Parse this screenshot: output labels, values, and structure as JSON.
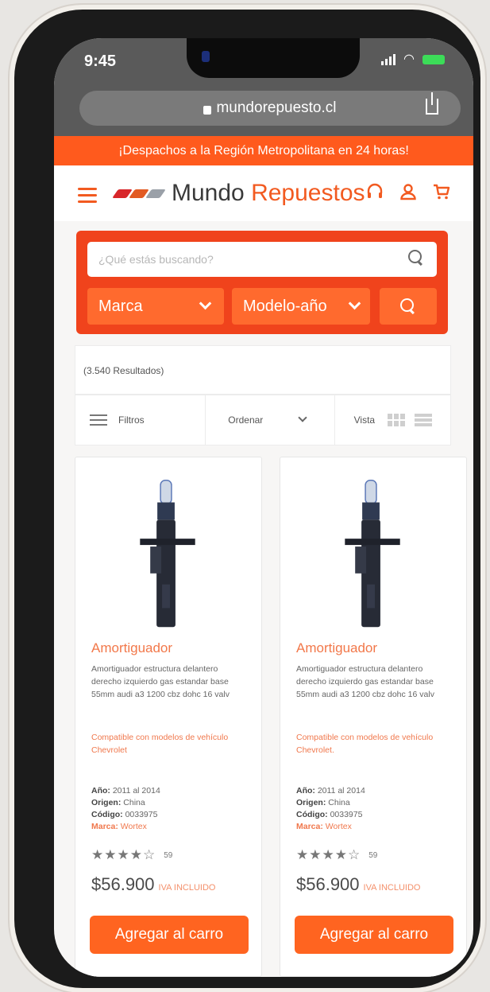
{
  "status": {
    "time": "9:45"
  },
  "browser": {
    "url": "mundorepuesto.cl"
  },
  "promo": {
    "text": "¡Despachos a la Región Metropolitana en 24 horas!"
  },
  "header": {
    "logo_part1": "Mundo",
    "logo_part2": "Repuestos",
    "logo_colors": [
      "#d8262a",
      "#e25a22",
      "#9aa0a8"
    ],
    "icons": [
      "headset-icon",
      "user-icon",
      "cart-icon"
    ]
  },
  "search": {
    "placeholder": "¿Qué estás buscando?",
    "brand_select": "Marca",
    "model_select": "Modelo-año"
  },
  "results": {
    "count_text": "(3.540 Resultados)"
  },
  "toolbar": {
    "filters": "Filtros",
    "sort": "Ordenar",
    "view": "Vista"
  },
  "products": [
    {
      "name": "Amortiguador",
      "description": "Amortiguador estructura delantero derecho izquierdo gas estandar base 55mm audi a3 1200 cbz dohc 16 valv",
      "compat": "Compatible con modelos de vehículo Chevrolet",
      "year_label": "Año:",
      "year": "2011 al 2014",
      "origin_label": "Origen:",
      "origin": "China",
      "code_label": "Código:",
      "code": "0033975",
      "brand_label": "Marca:",
      "brand": "Wortex",
      "stars": "★★★★☆",
      "rating": 3.5,
      "rating_count": "59",
      "price": "$56.900",
      "price_note": "IVA INCLUIDO",
      "cta": "Agregar al carro"
    },
    {
      "name": "Amortiguador",
      "description": "Amortiguador estructura delantero derecho izquierdo gas estandar base 55mm audi a3 1200 cbz dohc 16 valv",
      "compat": "Compatible con modelos de vehículo Chevrolet.",
      "year_label": "Año:",
      "year": "2011 al 2014",
      "origin_label": "Origen:",
      "origin": "China",
      "code_label": "Código:",
      "code": "0033975",
      "brand_label": "Marca:",
      "brand": "Wortex",
      "stars": "★★★★☆",
      "rating": 3.5,
      "rating_count": "59",
      "price": "$56.900",
      "price_note": "IVA INCLUIDO",
      "cta": "Agregar al carro"
    }
  ],
  "colors": {
    "accent": "#ff5a1d",
    "search_bg": "#f0431c",
    "button": "#ff6420"
  }
}
